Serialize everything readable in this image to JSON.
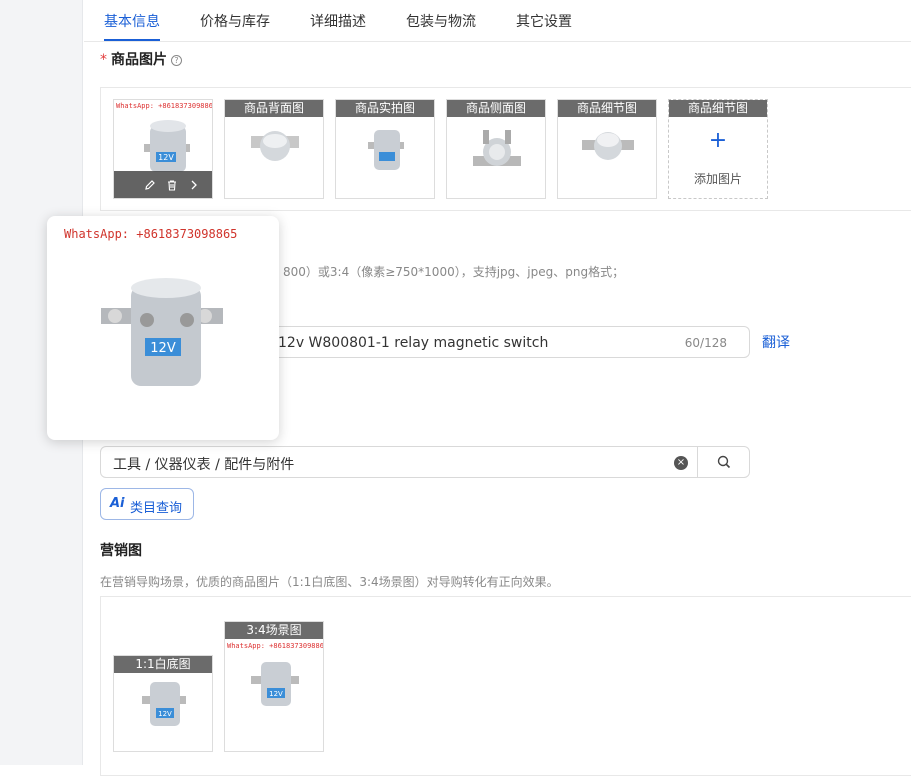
{
  "tabs": [
    {
      "label": "基本信息",
      "active": true
    },
    {
      "label": "价格与库存"
    },
    {
      "label": "详细描述"
    },
    {
      "label": "包装与物流"
    },
    {
      "label": "其它设置"
    }
  ],
  "product_images": {
    "required_mark": "*",
    "label": "商品图片",
    "help_icon": "question-circle-icon",
    "watermark": "WhatsApp: +8618373098865",
    "slots": [
      {
        "label": "商品背面图"
      },
      {
        "label": "商品实拍图"
      },
      {
        "label": "商品侧面图"
      },
      {
        "label": "商品细节图"
      }
    ],
    "add_slot": {
      "label": "商品细节图",
      "action": "添加图片"
    },
    "actions": [
      "edit-icon",
      "delete-icon",
      "chevron-right-icon"
    ]
  },
  "image_hint": "800）或3:4（像素≥750*1000），支持jpg、jpeg、png格式；",
  "title": {
    "value": "12v W800801-1 relay magnetic switch",
    "count": "60/128",
    "translate_label": "翻译"
  },
  "category": {
    "value": "工具 / 仪器仪表 / 配件与附件",
    "ai_query_label": "类目查询"
  },
  "marketing": {
    "label": "营销图",
    "hint": "在营销导购场景，优质的商品图片（1:1白底图、3:4场景图）对导购转化有正向效果。",
    "slots": [
      {
        "label": "1:1白底图"
      },
      {
        "label": "3:4场景图"
      }
    ]
  },
  "preview": {
    "watermark": "WhatsApp: +8618373098865",
    "badge": "12V"
  },
  "colors": {
    "accent": "#1a5fd6",
    "required": "#e23b3b"
  }
}
